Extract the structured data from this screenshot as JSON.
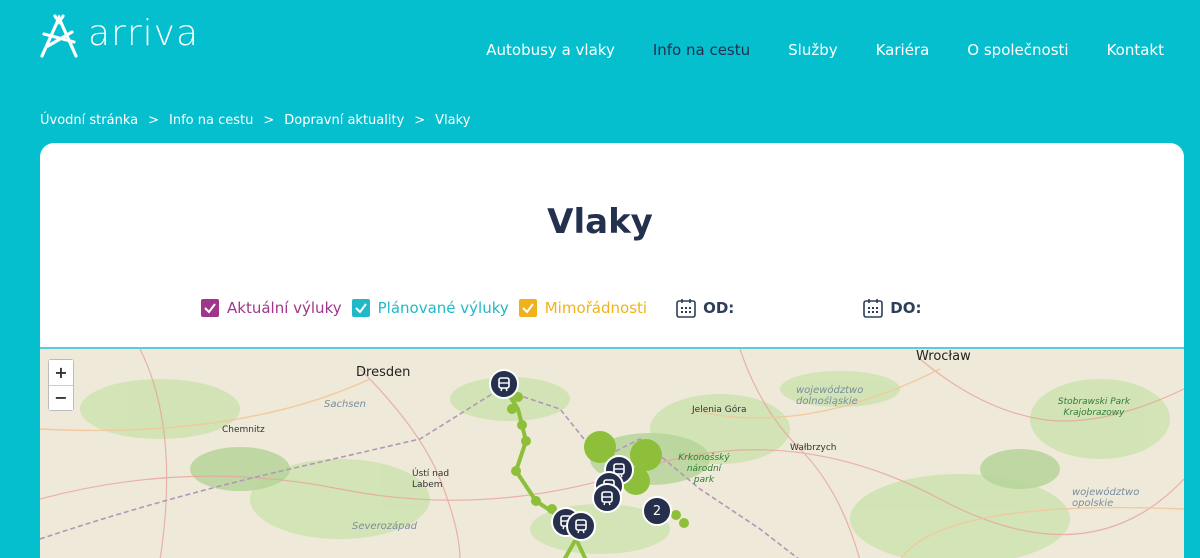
{
  "header": {
    "logo_text": "arriva",
    "nav": [
      {
        "label": "Autobusy a vlaky"
      },
      {
        "label": "Info na cestu"
      },
      {
        "label": "Služby"
      },
      {
        "label": "Kariéra"
      },
      {
        "label": "O společnosti"
      },
      {
        "label": "Kontakt"
      }
    ]
  },
  "breadcrumb": [
    "Úvodní stránka",
    "Info na cestu",
    "Dopravní aktuality",
    "Vlaky"
  ],
  "page_title": "Vlaky",
  "filters": [
    {
      "label": "Aktuální výluky",
      "checked": true,
      "color": "#a0368c"
    },
    {
      "label": "Plánované výluky",
      "checked": true,
      "color": "#21b9c7"
    },
    {
      "label": "Mimořádnosti",
      "checked": true,
      "color": "#f0b21a"
    }
  ],
  "date_from_label": "OD:",
  "date_to_label": "DO:",
  "map": {
    "zoom_in": "+",
    "zoom_out": "−",
    "cluster_count": "2",
    "labels": {
      "wroclaw": "Wrocław",
      "dresden": "Dresden",
      "sachsen": "Sachsen",
      "chemnitz": "Chemnitz",
      "jelenia": "Jelenia Góra",
      "walbrzych": "Wałbrzych",
      "dolnoslaskie": "województwo dolnośląskie",
      "stobrawski": "Stobrawski Park Krajobrazowy",
      "krkonose": "Krkonošský národní park",
      "usti": "Ústí nad Labem",
      "severozapad": "Severozápad",
      "opolskie": "województwo opolskie"
    }
  },
  "colors": {
    "brand": "#05bfcf",
    "dark": "#23304e",
    "route": "#8dbf3a"
  }
}
